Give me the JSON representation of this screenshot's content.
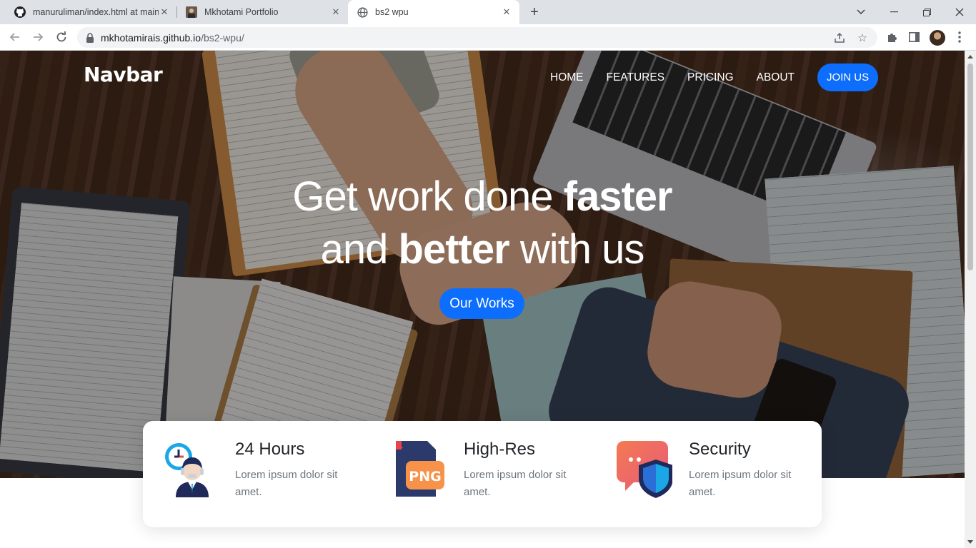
{
  "browser": {
    "tabs": [
      {
        "title": "manuruliman/index.html at main",
        "active": false
      },
      {
        "title": "Mkhotami Portfolio",
        "active": false
      },
      {
        "title": "bs2 wpu",
        "active": true
      }
    ],
    "url_host": "mkhotamirais.github.io",
    "url_path": "/bs2-wpu/"
  },
  "navbar": {
    "brand": "Navbar",
    "links": [
      "HOME",
      "FEATURES",
      "PRICING",
      "ABOUT"
    ],
    "cta": "JOIN US"
  },
  "hero": {
    "line1_light": "Get work done ",
    "line1_bold": "faster",
    "line2_light_a": "and ",
    "line2_bold": "better",
    "line2_light_b": " with us",
    "button": "Our Works"
  },
  "features": [
    {
      "title": "24 Hours",
      "desc": "Lorem ipsum dolor sit amet."
    },
    {
      "title": "High-Res",
      "desc": "Lorem ipsum dolor sit amet.",
      "badge": "PNG"
    },
    {
      "title": "Security",
      "desc": "Lorem ipsum dolor sit amet."
    }
  ],
  "colors": {
    "primary": "#0d6efd",
    "text_dark": "#212529",
    "text_muted": "#6c757d"
  }
}
